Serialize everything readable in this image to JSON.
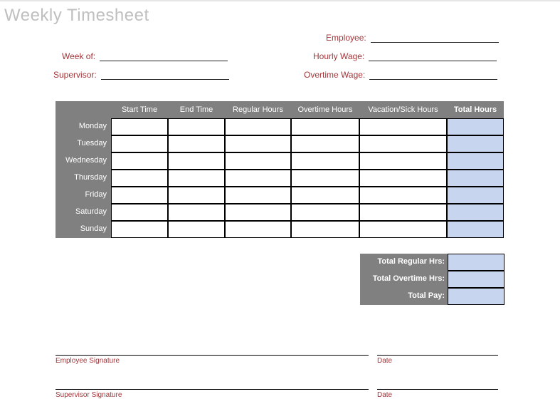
{
  "title": "Weekly Timesheet",
  "fields": {
    "employee": "Employee:",
    "week_of": "Week of:",
    "hourly_wage": "Hourly Wage:",
    "supervisor": "Supervisor:",
    "overtime_wage": "Overtime Wage:"
  },
  "columns": {
    "start_time": "Start Time",
    "end_time": "End Time",
    "regular_hours": "Regular Hours",
    "overtime_hours": "Overtime Hours",
    "vacation_sick": "Vacation/Sick Hours",
    "total_hours": "Total Hours"
  },
  "days": {
    "mon": "Monday",
    "tue": "Tuesday",
    "wed": "Wednesday",
    "thu": "Thursday",
    "fri": "Friday",
    "sat": "Saturday",
    "sun": "Sunday"
  },
  "summary": {
    "total_regular": "Total Regular Hrs:",
    "total_overtime": "Total Overtime Hrs:",
    "total_pay": "Total Pay:"
  },
  "signatures": {
    "employee": "Employee Signature",
    "supervisor": "Supervisor Signature",
    "date": "Date"
  }
}
